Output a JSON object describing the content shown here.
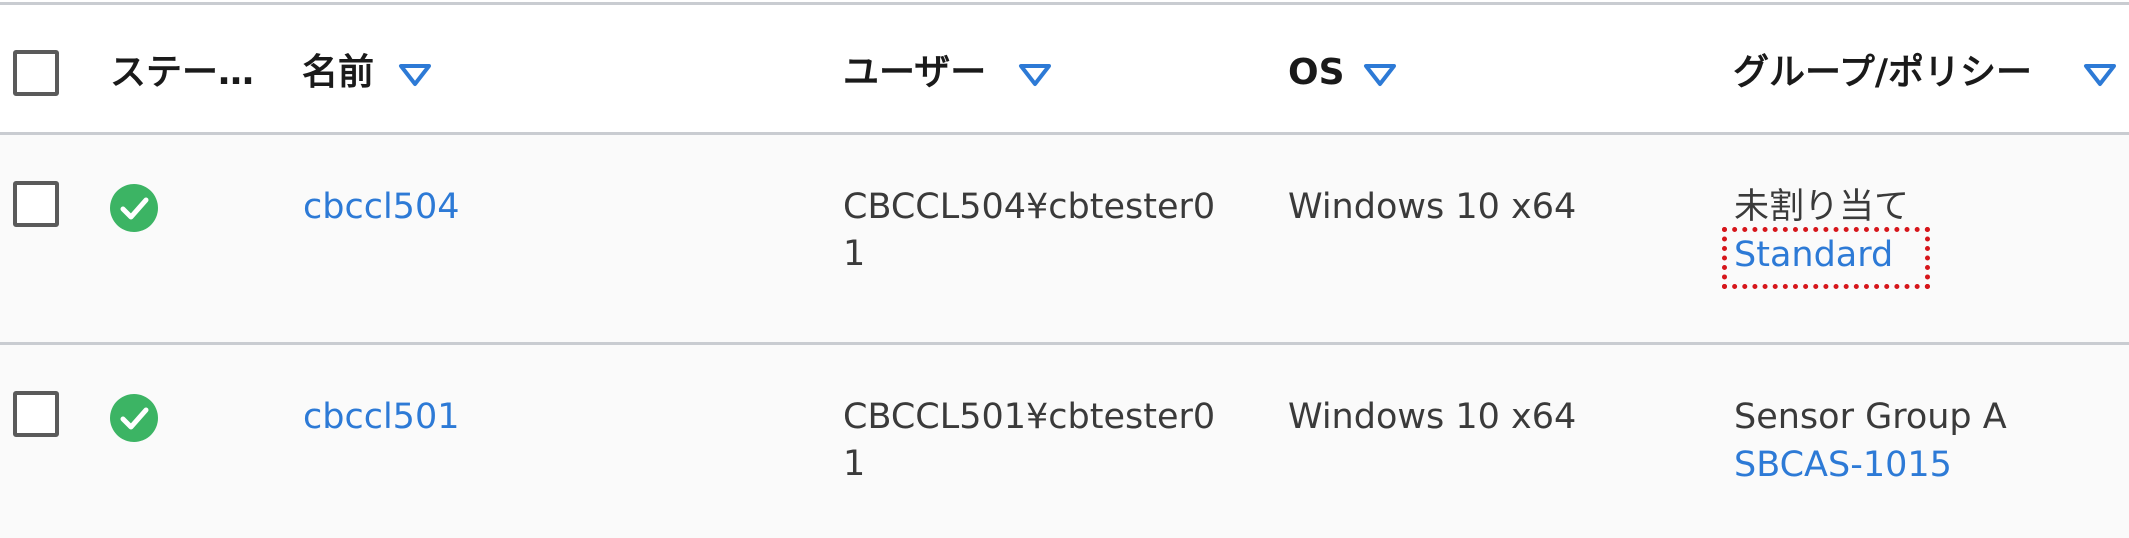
{
  "header": {
    "status_label": "ステー…",
    "name_label": "名前",
    "user_label": "ユーザー",
    "os_label": "OS",
    "group_label": "グループ/ポリシー"
  },
  "rows": [
    {
      "status": "ok",
      "name": "cbccl504",
      "user_line1": "CBCCL504¥cbtester0",
      "user_line2": "1",
      "os": "Windows 10 x64",
      "group": "未割り当て",
      "policy": "Standard"
    },
    {
      "status": "ok",
      "name": "cbccl501",
      "user_line1": "CBCCL501¥cbtester0",
      "user_line2": "1",
      "os": "Windows 10 x64",
      "group": "Sensor Group A",
      "policy": "SBCAS-1015"
    }
  ],
  "colors": {
    "link": "#2d7ad6",
    "status_ok": "#3cb464",
    "sort_icon": "#2d7ad6",
    "highlight_border": "#d6161b"
  },
  "icons": {
    "status_ok": "check-circle-icon",
    "sort": "sort-descending-triangle-icon"
  }
}
